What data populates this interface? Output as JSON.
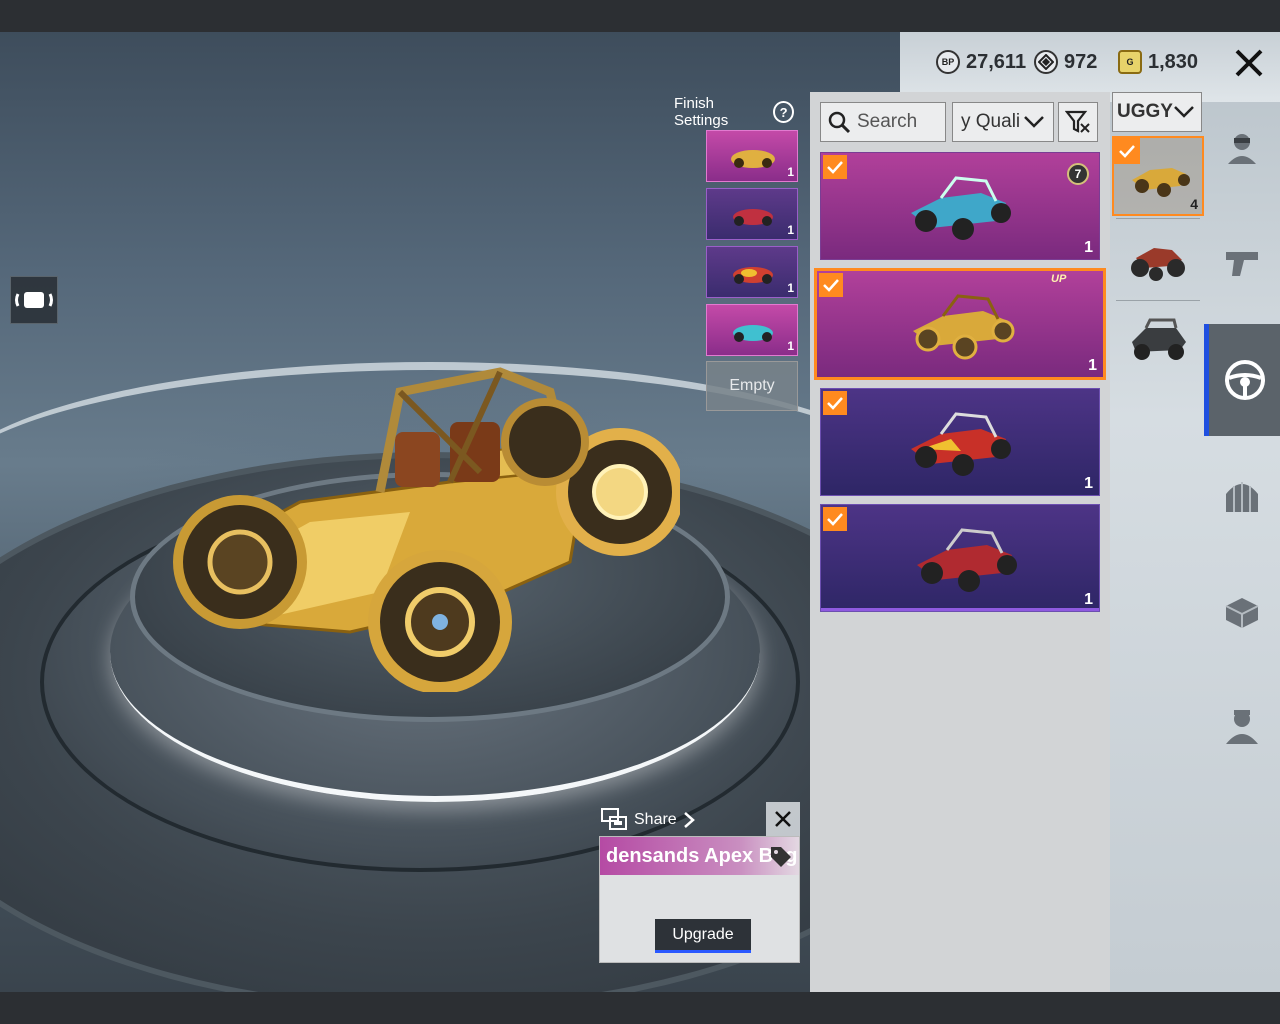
{
  "currencies": {
    "bp": {
      "icon": "bp-coin-icon",
      "glyph": "BP",
      "value": "27,611"
    },
    "ag": {
      "icon": "ag-coin-icon",
      "value": "972"
    },
    "uc": {
      "icon": "uc-coin-icon",
      "glyph": "G",
      "value": "1,830"
    }
  },
  "finish": {
    "title": "Finish Settings",
    "help": "?",
    "slots": [
      {
        "count": "1",
        "style": "pink"
      },
      {
        "count": "1",
        "style": "purple"
      },
      {
        "count": "1",
        "style": "purple"
      },
      {
        "count": "1",
        "style": "pink"
      }
    ],
    "empty_label": "Empty"
  },
  "filters": {
    "search_placeholder": "Search",
    "quality_label": "y Quali",
    "category_label": "UGGY"
  },
  "skins": [
    {
      "count": "1",
      "badge": "7",
      "style": "pink",
      "checked": true
    },
    {
      "count": "1",
      "badge": "UP",
      "style": "pink",
      "checked": true,
      "selected": true
    },
    {
      "count": "1",
      "style": "purple",
      "checked": true
    },
    {
      "count": "1",
      "style": "purple",
      "checked": true
    }
  ],
  "vehicles": [
    {
      "count": "4",
      "selected": true
    },
    {
      "count": ""
    },
    {
      "count": ""
    }
  ],
  "nav": [
    "character-icon",
    "gun-icon",
    "steering-wheel-icon",
    "parachute-icon",
    "crate-icon",
    "companion-icon"
  ],
  "popup": {
    "share_label": "Share",
    "item_name": "densands Apex Bug",
    "upgrade_label": "Upgrade"
  },
  "colors": {
    "accent": "#ff8a1f",
    "active_nav": "#1f4fe0",
    "pink_card": "#b1409a",
    "purple_card": "#4d3486"
  }
}
